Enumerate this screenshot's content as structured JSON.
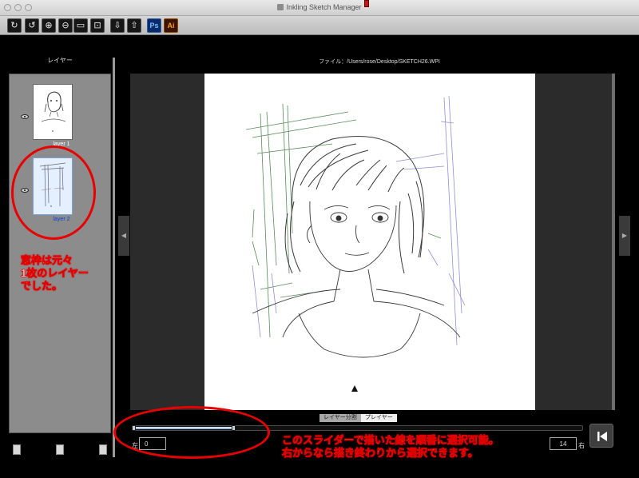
{
  "window": {
    "title": "Inkling Sketch Manager"
  },
  "toolbar": {
    "buttons": [
      {
        "icon": "rotate-cw-icon",
        "glyph": "↻"
      },
      {
        "icon": "rotate-ccw-icon",
        "glyph": "↺"
      },
      {
        "icon": "zoom-in-icon",
        "glyph": "⊕"
      },
      {
        "icon": "zoom-out-icon",
        "glyph": "⊖"
      },
      {
        "icon": "fit-window-icon",
        "glyph": "▭"
      },
      {
        "icon": "actual-size-icon",
        "glyph": "⊡"
      },
      {
        "icon": "import-icon",
        "glyph": "⇩"
      },
      {
        "icon": "export-icon",
        "glyph": "⇧"
      }
    ],
    "ps_label": "Ps",
    "ai_label": "Ai"
  },
  "layers_panel": {
    "title": "レイヤー",
    "layers": [
      {
        "name": "layer 1",
        "selected": false
      },
      {
        "name": "layer 2",
        "selected": true
      }
    ]
  },
  "canvas": {
    "file_label": "ファイル：/Users/rose/Desktop/SKETCH26.WPI"
  },
  "modes": {
    "split": "レイヤー分割",
    "player": "プレイヤー"
  },
  "slider": {
    "left_label": "左",
    "left_value": "0",
    "right_label": "右",
    "right_value": "14"
  },
  "annotations": {
    "layer_note": [
      "窓枠は元々",
      "1枚のレイヤー",
      "でした。"
    ],
    "slider_note": [
      "このスライダーで描いた線を順番に選択可能。",
      "右からなら描き終わりから選択できます。"
    ]
  },
  "colors": {
    "annotation_red": "#e80000",
    "selection_blue": "#1440d8"
  }
}
